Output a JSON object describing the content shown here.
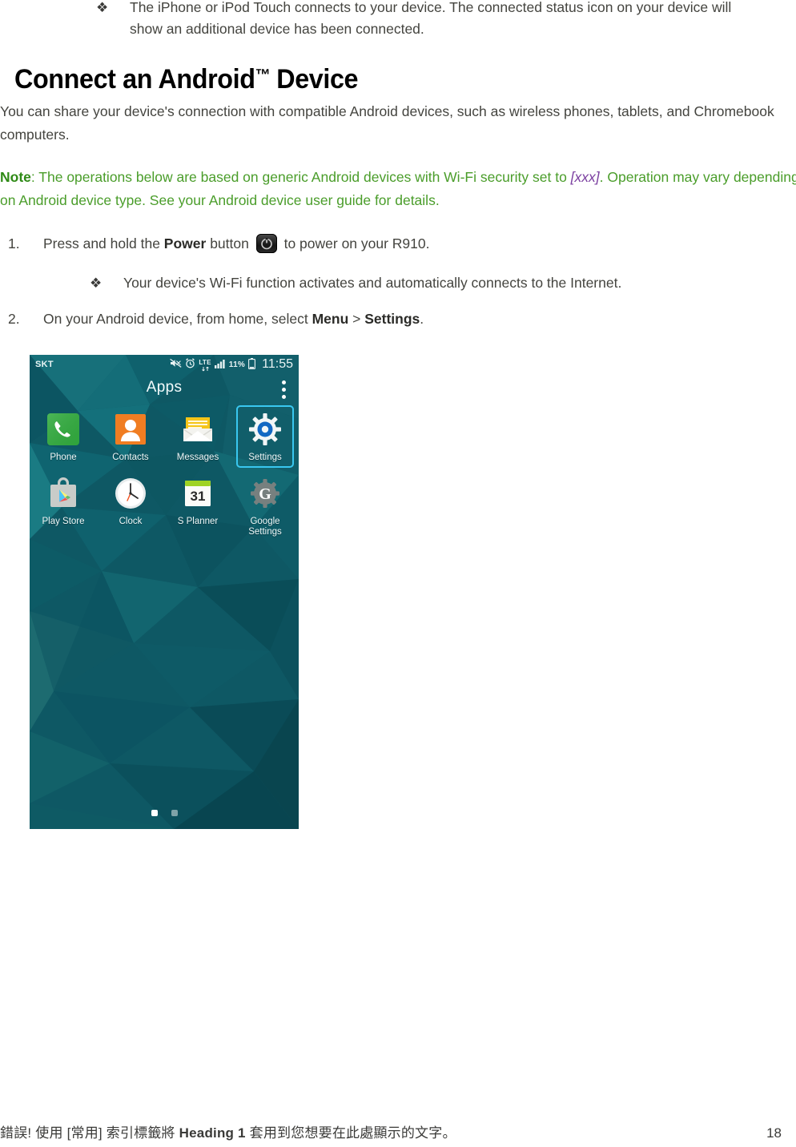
{
  "document": {
    "top_bullet": {
      "glyph": "❖",
      "text": "The iPhone or iPod Touch connects to your device. The connected status icon on your device will show an additional device has been connected."
    },
    "heading": {
      "before_tm": "Connect an Android",
      "tm": "™",
      "after_tm": " Device"
    },
    "intro_paragraph": "You can share your device's connection with compatible Android devices, such as wireless phones, tablets, and Chromebook computers.",
    "note": {
      "label": "Note",
      "part1": ": The operations below are based on generic Android devices with Wi-Fi security set to ",
      "placeholder": "[xxx]",
      "part2": ". Operation may vary depending on Android device type. See your Android device user guide for details.",
      "color": "#4a9d2a",
      "placeholder_color": "#7b3fa0"
    },
    "steps": [
      {
        "number": "1.",
        "text_before_bold": "Press and hold the ",
        "bold": "Power",
        "text_after_bold": " button ",
        "icon": "power-button-icon",
        "text_tail": " to power on your R910."
      },
      {
        "number": "2.",
        "text_before_bold": "On your Android device, from home, select ",
        "bold": "Menu",
        "separator": " > ",
        "bold2": "Settings",
        "text_tail": "."
      }
    ],
    "sub_bullet": {
      "glyph": "❖",
      "text": "Your device's Wi-Fi function activates and automatically connects to the Internet."
    }
  },
  "phone_screenshot": {
    "statusbar": {
      "carrier": "SKT",
      "icons": [
        "mute-icon",
        "alarm-icon",
        "lte-icon",
        "signal-icon"
      ],
      "lte_label": "LTE",
      "battery_percent": "11%",
      "time": "11:55"
    },
    "title": "Apps",
    "overflow_menu": "overflow-menu-icon",
    "apps": [
      [
        {
          "label": "Phone",
          "icon": "phone-icon",
          "selected": false
        },
        {
          "label": "Contacts",
          "icon": "contacts-icon",
          "selected": false
        },
        {
          "label": "Messages",
          "icon": "messages-icon",
          "selected": false
        },
        {
          "label": "Settings",
          "icon": "settings-gear-icon",
          "selected": true
        }
      ],
      [
        {
          "label": "Play Store",
          "icon": "play-store-icon",
          "selected": false
        },
        {
          "label": "Clock",
          "icon": "clock-icon",
          "selected": false
        },
        {
          "label": "S Planner",
          "icon": "calendar-icon",
          "day": "31",
          "selected": false
        },
        {
          "label": "Google\nSettings",
          "icon": "google-settings-icon",
          "selected": false
        }
      ]
    ],
    "page_dots": {
      "count": 2,
      "active_index": 0
    },
    "highlight_color": "#39c7f0"
  },
  "footer": {
    "text_before_bold": "錯誤! 使用 [常用] 索引標籤將 ",
    "bold": "Heading 1",
    "text_after_bold": " 套用到您想要在此處顯示的文字。",
    "page_number": "18"
  }
}
